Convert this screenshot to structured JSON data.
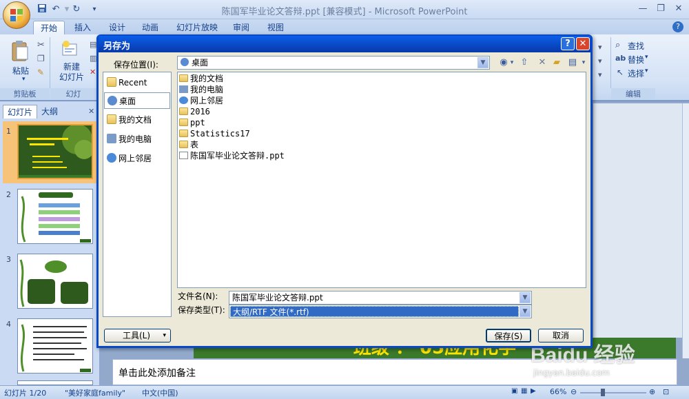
{
  "window": {
    "title": "陈国军毕业论文答辩.ppt [兼容模式] - Microsoft PowerPoint"
  },
  "ribbon": {
    "tabs": [
      "开始",
      "插入",
      "设计",
      "动画",
      "幻灯片放映",
      "审阅",
      "视图"
    ],
    "paste_label": "粘贴",
    "clipboard_group": "剪贴板",
    "new_slide_label": "新建\n幻灯片",
    "slides_group": "幻灯",
    "find_label": "查找",
    "replace_label": "替换",
    "select_label": "选择",
    "edit_group": "编辑"
  },
  "left_pane": {
    "tabs": [
      "幻灯片",
      "大纲"
    ],
    "slide_numbers": [
      "1",
      "2",
      "3",
      "4"
    ]
  },
  "slide": {
    "visible_text": "班级   ：  05应用化学"
  },
  "notes": {
    "placeholder": "单击此处添加备注"
  },
  "status_bar": {
    "slide_info": "幻灯片 1/20",
    "theme": "\"美好家庭family\"",
    "language": "中文(中国)",
    "zoom": "66%"
  },
  "watermark": {
    "brand": "Baidu 经验",
    "url": "jingyan.baidu.com"
  },
  "dialog": {
    "title": "另存为",
    "location_label": "保存位置(I):",
    "location_value": "桌面",
    "places": [
      "Recent",
      "桌面",
      "我的文档",
      "我的电脑",
      "网上邻居"
    ],
    "selected_place": "桌面",
    "files": [
      {
        "name": "我的文档",
        "icon": "my-documents-icon"
      },
      {
        "name": "我的电脑",
        "icon": "my-computer-icon"
      },
      {
        "name": "网上邻居",
        "icon": "network-icon"
      },
      {
        "name": "2016",
        "icon": "folder-icon"
      },
      {
        "name": "ppt",
        "icon": "folder-icon"
      },
      {
        "name": "Statistics17",
        "icon": "folder-icon"
      },
      {
        "name": "表",
        "icon": "folder-icon"
      },
      {
        "name": "陈国军毕业论文答辩.ppt",
        "icon": "ppt-file-icon"
      }
    ],
    "filename_label": "文件名(N):",
    "filename_value": "陈国军毕业论文答辩.ppt",
    "filetype_label": "保存类型(T):",
    "filetype_value": "大纲/RTF 文件(*.rtf)",
    "tools_label": "工具(L)",
    "save_label": "保存(S)",
    "cancel_label": "取消"
  },
  "colors": {
    "dialog_title_blue": "#0a47c3",
    "selection_blue": "#316ac5",
    "ribbon_text": "#15428b",
    "slide_green": "#3a7a2a",
    "slide_yellow": "#ffe400"
  }
}
